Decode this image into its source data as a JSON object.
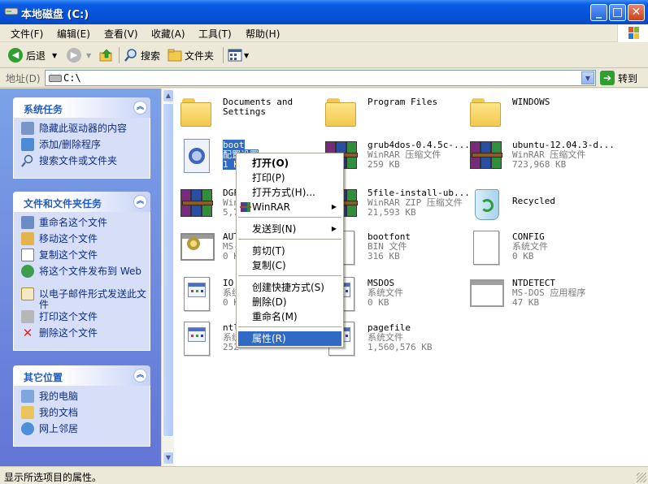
{
  "window": {
    "title": "本地磁盘  (C:)",
    "controls": {
      "minimize": "_",
      "maximize": "□",
      "close": "✕"
    }
  },
  "menubar": {
    "items": [
      {
        "label": "文件(F)"
      },
      {
        "label": "编辑(E)"
      },
      {
        "label": "查看(V)"
      },
      {
        "label": "收藏(A)"
      },
      {
        "label": "工具(T)"
      },
      {
        "label": "帮助(H)"
      }
    ]
  },
  "toolbar": {
    "back_label": "后退",
    "search_label": "搜索",
    "folders_label": "文件夹"
  },
  "address": {
    "label": "地址(D)",
    "value": "C:\\",
    "go_label": "转到"
  },
  "leftpane": {
    "system_tasks": {
      "title": "系统任务",
      "items": [
        {
          "label": "隐藏此驱动器的内容"
        },
        {
          "label": "添加/删除程序"
        },
        {
          "label": "搜索文件或文件夹"
        }
      ]
    },
    "file_tasks": {
      "title": "文件和文件夹任务",
      "items": [
        {
          "label": "重命名这个文件"
        },
        {
          "label": "移动这个文件"
        },
        {
          "label": "复制这个文件"
        },
        {
          "label": "将这个文件发布到 Web"
        },
        {
          "label": "以电子邮件形式发送此文件"
        },
        {
          "label": "打印这个文件"
        },
        {
          "label": "删除这个文件"
        }
      ]
    },
    "other_places": {
      "title": "其它位置",
      "items": [
        {
          "label": "我的电脑"
        },
        {
          "label": "我的文档"
        },
        {
          "label": "网上邻居"
        }
      ]
    }
  },
  "files": [
    {
      "name": "Documents and",
      "name2": "Settings",
      "type": "",
      "size": "",
      "icon": "folder-icon"
    },
    {
      "name": "Program Files",
      "name2": "",
      "type": "",
      "size": "",
      "icon": "folder-icon"
    },
    {
      "name": "WINDOWS",
      "name2": "",
      "type": "",
      "size": "",
      "icon": "folder-icon"
    },
    {
      "name": "boot",
      "name2": "",
      "type": "配置设置",
      "size": "1 KB",
      "icon": "config-settings-icon"
    },
    {
      "name": "grub4dos-0.4.5c-...",
      "name2": "",
      "type": "WinRAR 压缩文件",
      "size": "259 KB",
      "icon": "winrar-archive-icon"
    },
    {
      "name": "ubuntu-12.04.3-d...",
      "name2": "",
      "type": "WinRAR 压缩文件",
      "size": "723,968 KB",
      "icon": "winrar-archive-icon"
    },
    {
      "name": "DGF",
      "name2": "",
      "type": "Win",
      "size": "5,74",
      "icon": "winrar-archive-icon"
    },
    {
      "name": "5file-install-ub...",
      "name2": "",
      "type": "WinRAR ZIP 压缩文件",
      "size": "21,593 KB",
      "icon": "winrar-zip-icon"
    },
    {
      "name": "Recycled",
      "name2": "",
      "type": "",
      "size": "",
      "icon": "recycle-bin-icon"
    },
    {
      "name": "AUTO",
      "name2": "",
      "type": "MS-",
      "size": "0 K",
      "icon": "config-file-icon"
    },
    {
      "name": "bootfont",
      "name2": "",
      "type": "BIN 文件",
      "size": "316 KB",
      "icon": "file-icon"
    },
    {
      "name": "CONFIG",
      "name2": "",
      "type": "系统文件",
      "size": "0 KB",
      "icon": "file-icon"
    },
    {
      "name": "IO",
      "name2": "",
      "type": "系统",
      "size": "0 K",
      "icon": "file-icon"
    },
    {
      "name": "MSDOS",
      "name2": "",
      "type": "系统文件",
      "size": "0 KB",
      "icon": "file-icon"
    },
    {
      "name": "NTDETECT",
      "name2": "",
      "type": "MS-DOS 应用程序",
      "size": "47 KB",
      "icon": "msdos-app-icon"
    },
    {
      "name": "ntl",
      "name2": "",
      "type": "系统",
      "size": "252",
      "icon": "file-icon"
    },
    {
      "name": "pagefile",
      "name2": "",
      "type": "系统文件",
      "size": "1,560,576 KB",
      "icon": "file-icon"
    }
  ],
  "context_menu": {
    "items": [
      {
        "label": "打开(O)"
      },
      {
        "label": "打印(P)"
      },
      {
        "label": "打开方式(H)..."
      },
      {
        "label": "WinRAR"
      },
      {
        "label": "发送到(N)"
      },
      {
        "label": "剪切(T)"
      },
      {
        "label": "复制(C)"
      },
      {
        "label": "创建快捷方式(S)"
      },
      {
        "label": "删除(D)"
      },
      {
        "label": "重命名(M)"
      },
      {
        "label": "属性(R)"
      }
    ]
  },
  "status": {
    "text": "显示所选项目的属性。"
  },
  "colors": {
    "title_blue": "#0653d8",
    "left_pane_blue": "#6375d6",
    "selection_blue": "#316ac5",
    "task_link": "#0c2b8a",
    "go_green": "#2f9f2f"
  }
}
